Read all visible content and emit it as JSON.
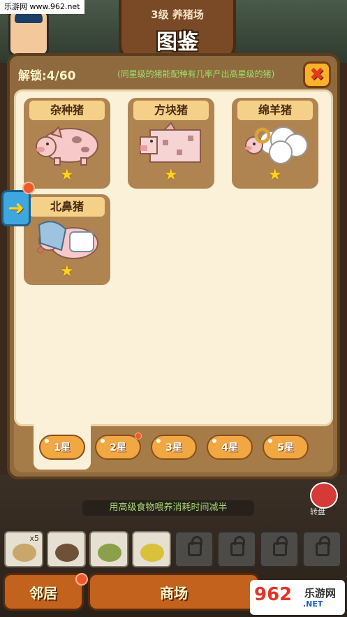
{
  "watermark_top": "乐游网 www.962.net",
  "header": {
    "level_title": "3级 养猪场",
    "main_title": "图鉴"
  },
  "panel": {
    "unlock_label": "解锁:4/60",
    "hint": "(同星级的猪能配种有几率产出高星级的猪)"
  },
  "cards": [
    {
      "name": "杂种猪",
      "stars": 1,
      "icon": "mixed-pig-icon"
    },
    {
      "name": "方块猪",
      "stars": 1,
      "icon": "block-pig-icon"
    },
    {
      "name": "绵羊猪",
      "stars": 1,
      "icon": "sheep-pig-icon"
    },
    {
      "name": "北鼻猪",
      "stars": 1,
      "icon": "baby-pig-icon"
    }
  ],
  "star_tabs": [
    "1星",
    "2星",
    "3星",
    "4星",
    "5星"
  ],
  "active_star_tab": 0,
  "tip": "用高级食物喂养消耗时间减半",
  "right_icon_label": "转盘",
  "food_slot_count_label": "x5",
  "bottom_buttons": [
    "邻居",
    "商场"
  ],
  "watermark_bottom": {
    "logo": "962",
    "cn": "乐游网",
    "url": ".NET"
  },
  "colors": {
    "panel": "#8f6a3e",
    "inner": "#fbf1d9",
    "card": "#b08451",
    "name_tag": "#f4d089",
    "tab": "#f1a742",
    "hint_text": "#9ee36b",
    "close_x": "#e23a1c"
  }
}
